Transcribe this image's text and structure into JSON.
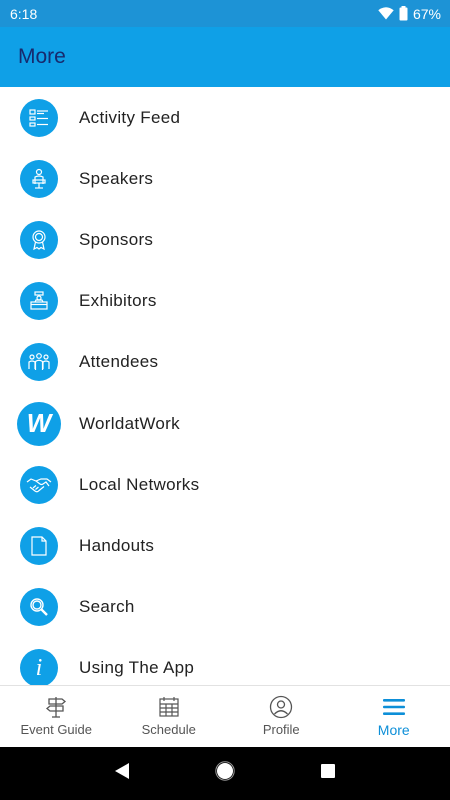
{
  "status_bar": {
    "time": "6:18",
    "battery": "67%"
  },
  "app_bar": {
    "title": "More"
  },
  "menu_items": [
    {
      "label": "Activity Feed",
      "icon": "activity-feed-icon"
    },
    {
      "label": "Speakers",
      "icon": "speaker-icon"
    },
    {
      "label": "Sponsors",
      "icon": "award-ribbon-icon"
    },
    {
      "label": "Exhibitors",
      "icon": "booth-icon"
    },
    {
      "label": "Attendees",
      "icon": "people-icon"
    },
    {
      "label": "WorldatWork",
      "icon": "worldatwork-logo",
      "logo_text": "W"
    },
    {
      "label": "Local Networks",
      "icon": "handshake-icon"
    },
    {
      "label": "Handouts",
      "icon": "document-icon"
    },
    {
      "label": "Search",
      "icon": "magnifier-icon"
    },
    {
      "label": "Using The App",
      "icon": "info-icon",
      "glyph": "i"
    }
  ],
  "bottom_nav": [
    {
      "label": "Event Guide",
      "icon": "signpost-icon",
      "active": false
    },
    {
      "label": "Schedule",
      "icon": "calendar-icon",
      "active": false
    },
    {
      "label": "Profile",
      "icon": "profile-icon",
      "active": false
    },
    {
      "label": "More",
      "icon": "hamburger-icon",
      "active": true
    }
  ],
  "colors": {
    "primary": "#0fa0e7",
    "status_bar": "#1d93d6",
    "title_text": "#172a6e",
    "active_tab": "#0d8fd8"
  }
}
